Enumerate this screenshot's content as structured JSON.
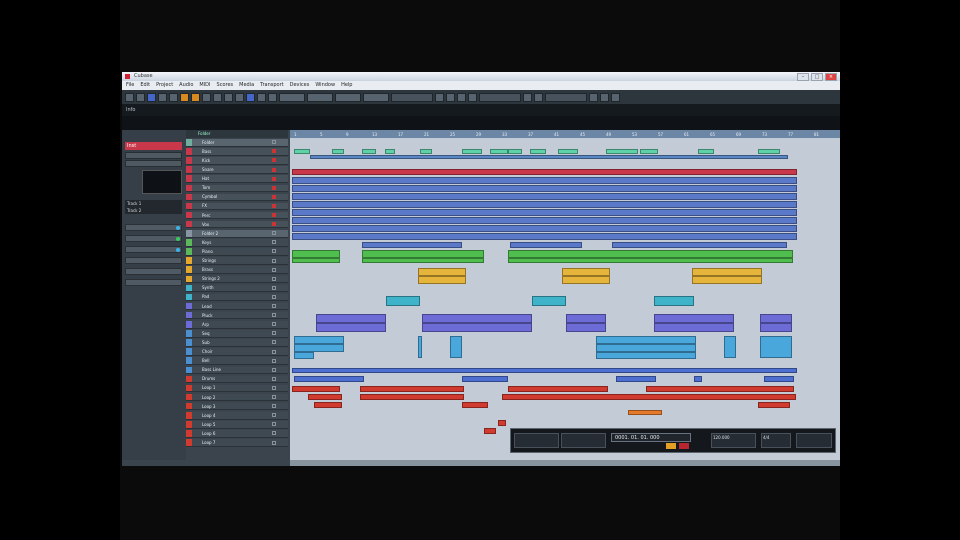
{
  "window": {
    "title": "Cubase"
  },
  "menu": [
    "File",
    "Edit",
    "Project",
    "Audio",
    "MIDI",
    "Scores",
    "Media",
    "Transport",
    "Devices",
    "Window",
    "Help"
  ],
  "toolbar": {
    "buttons": 30
  },
  "info_line": {
    "label": "Info"
  },
  "inspector": {
    "track_name": "Inst",
    "list_items": [
      "Track 1",
      "Track 2"
    ]
  },
  "tracklist_header": {
    "label": "Folder"
  },
  "tracks": [
    {
      "name": "Folder",
      "color": "#6fae9f",
      "type": "folder"
    },
    {
      "name": "Bass",
      "color": "#c8384a"
    },
    {
      "name": "Kick",
      "color": "#c8384a"
    },
    {
      "name": "Snare",
      "color": "#c8384a"
    },
    {
      "name": "Hat",
      "color": "#c8384a"
    },
    {
      "name": "Tom",
      "color": "#c8384a"
    },
    {
      "name": "Cymbal",
      "color": "#c8384a"
    },
    {
      "name": "FX",
      "color": "#c8384a"
    },
    {
      "name": "Perc",
      "color": "#c8384a"
    },
    {
      "name": "Vox",
      "color": "#c8384a"
    },
    {
      "name": "Folder 2",
      "color": "#8795a2",
      "type": "folder"
    },
    {
      "name": "Keys",
      "color": "#5cb85a"
    },
    {
      "name": "Piano",
      "color": "#5cb85a"
    },
    {
      "name": "Strings",
      "color": "#e5a82f"
    },
    {
      "name": "Brass",
      "color": "#e5a82f"
    },
    {
      "name": "Strings 2",
      "color": "#e5a82f"
    },
    {
      "name": "Synth",
      "color": "#3fb3c9"
    },
    {
      "name": "Pad",
      "color": "#3fb3c9"
    },
    {
      "name": "Lead",
      "color": "#6d6bd6"
    },
    {
      "name": "Pluck",
      "color": "#6d6bd6"
    },
    {
      "name": "Arp",
      "color": "#6d6bd6"
    },
    {
      "name": "Seq",
      "color": "#4c8fd1"
    },
    {
      "name": "Sub",
      "color": "#4c8fd1"
    },
    {
      "name": "Choir",
      "color": "#4c8fd1"
    },
    {
      "name": "Bell",
      "color": "#4c8fd1"
    },
    {
      "name": "Bass Line",
      "color": "#4c8fd1"
    },
    {
      "name": "Drums",
      "color": "#d13a2f"
    },
    {
      "name": "Loop 1",
      "color": "#d13a2f"
    },
    {
      "name": "Loop 2",
      "color": "#d13a2f"
    },
    {
      "name": "Loop 3",
      "color": "#d13a2f"
    },
    {
      "name": "Loop 4",
      "color": "#d13a2f"
    },
    {
      "name": "Loop 5",
      "color": "#d13a2f"
    },
    {
      "name": "Loop 6",
      "color": "#d13a2f"
    },
    {
      "name": "Loop 7",
      "color": "#d13a2f"
    }
  ],
  "ruler_marks": [
    "1",
    "5",
    "9",
    "13",
    "17",
    "21",
    "25",
    "29",
    "33",
    "37",
    "41",
    "45",
    "49",
    "53",
    "57",
    "61",
    "65",
    "69",
    "73",
    "77",
    "81"
  ],
  "transport": {
    "time": "0001. 01. 01. 000",
    "tempo": "120.000",
    "signature": "4/4"
  }
}
